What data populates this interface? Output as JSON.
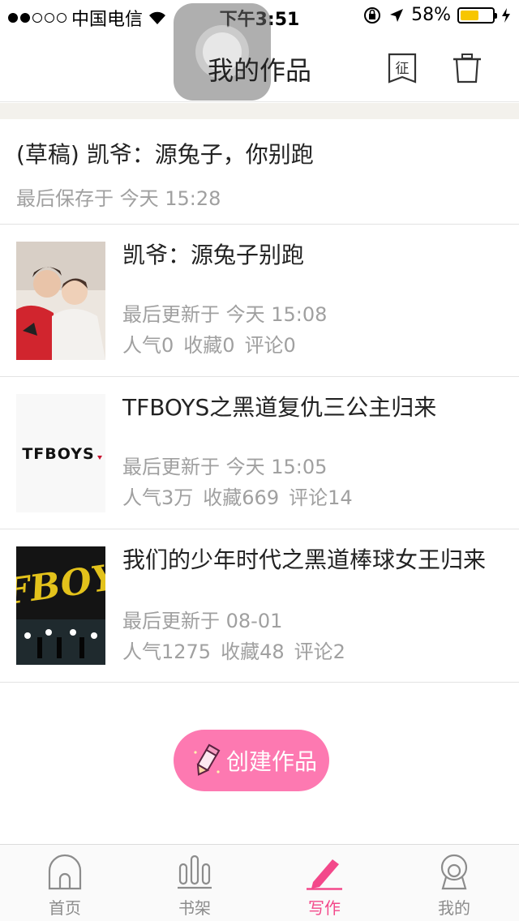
{
  "status_bar": {
    "carrier": "中国电信",
    "time": "下午3:51",
    "battery": "58%",
    "battery_level": 0.58
  },
  "nav": {
    "title": "我的作品",
    "contest_icon_text": "征",
    "contest_icon": "contest-icon",
    "trash_icon": "trash-icon"
  },
  "draft": {
    "title": "(草稿) 凯爷：源兔子，你别跑",
    "saved": "最后保存于 今天 15:28"
  },
  "works": [
    {
      "title": "凯爷：源兔子别跑",
      "updated": "最后更新于 今天 15:08",
      "popularity": "人气0",
      "favorites": "收藏0",
      "comments": "评论0"
    },
    {
      "title": "TFBOYS之黑道复仇三公主归来",
      "cover_text": "TFBOYS",
      "updated": "最后更新于 今天 15:05",
      "popularity": "人气3万",
      "favorites": "收藏669",
      "comments": "评论14"
    },
    {
      "title": "我们的少年时代之黑道棒球女王归来",
      "cover_text": "TFBOYS",
      "updated": "最后更新于 08-01",
      "popularity": "人气1275",
      "favorites": "收藏48",
      "comments": "评论2"
    }
  ],
  "create_button": {
    "label": "创建作品",
    "icon": "pencil-icon"
  },
  "tabs": [
    {
      "label": "首页",
      "icon": "home-icon"
    },
    {
      "label": "书架",
      "icon": "bookshelf-icon"
    },
    {
      "label": "写作",
      "icon": "write-icon",
      "active": true
    },
    {
      "label": "我的",
      "icon": "profile-icon"
    }
  ],
  "colors": {
    "accent": "#f3488a",
    "button": "#fd79b1",
    "meta_text": "#a0a0a0",
    "battery": "#f7c600"
  }
}
